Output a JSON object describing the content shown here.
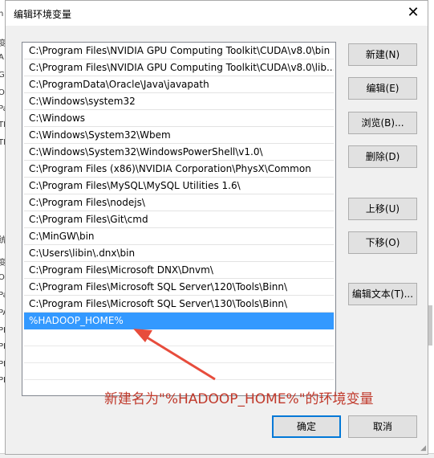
{
  "background_window": {
    "left_glyphs": [
      "n",
      "变",
      "A",
      "G",
      "O",
      "Pa",
      "TE",
      "TN",
      "统",
      "变",
      "O",
      "Pa",
      "PA",
      "PF",
      "PF",
      "PF",
      "PF"
    ]
  },
  "dialog": {
    "title": "编辑环境变量",
    "close_glyph": "✕",
    "paths": [
      "C:\\Program Files\\NVIDIA GPU Computing Toolkit\\CUDA\\v8.0\\bin",
      "C:\\Program Files\\NVIDIA GPU Computing Toolkit\\CUDA\\v8.0\\lib...",
      "C:\\ProgramData\\Oracle\\Java\\javapath",
      "C:\\Windows\\system32",
      "C:\\Windows",
      "C:\\Windows\\System32\\Wbem",
      "C:\\Windows\\System32\\WindowsPowerShell\\v1.0\\",
      "C:\\Program Files (x86)\\NVIDIA Corporation\\PhysX\\Common",
      "C:\\Program Files\\MySQL\\MySQL Utilities 1.6\\",
      "C:\\Program Files\\nodejs\\",
      "C:\\Program Files\\Git\\cmd",
      "C:\\MinGW\\bin",
      "C:\\Users\\libin\\.dnx\\bin",
      "C:\\Program Files\\Microsoft DNX\\Dnvm\\",
      "C:\\Program Files\\Microsoft SQL Server\\120\\Tools\\Binn\\",
      "C:\\Program Files\\Microsoft SQL Server\\130\\Tools\\Binn\\",
      "%HADOOP_HOME%"
    ],
    "selected_index": 16,
    "buttons": {
      "new": "新建(N)",
      "edit": "编辑(E)",
      "browse": "浏览(B)...",
      "delete": "删除(D)",
      "move_up": "上移(U)",
      "move_down": "下移(O)",
      "edit_text": "编辑文本(T)...",
      "ok": "确定",
      "cancel": "取消"
    },
    "annotation": "新建名为\"%HADOOP_HOME%\"的环境变量"
  },
  "colors": {
    "selection": "#3399ff",
    "annotation": "#c0392b"
  }
}
